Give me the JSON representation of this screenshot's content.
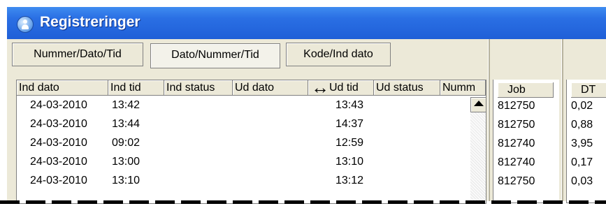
{
  "window": {
    "title": "Registreringer",
    "icon": "user-icon"
  },
  "tabs": [
    {
      "label": "Nummer/Dato/Tid",
      "selected": false
    },
    {
      "label": "Dato/Nummer/Tid",
      "selected": true
    },
    {
      "label": "Kode/Ind dato",
      "selected": false
    }
  ],
  "main_table": {
    "columns": [
      "Ind dato",
      "Ind tid",
      "Ind status",
      "Ud dato",
      "Ud tid",
      "Ud status",
      "Numm"
    ],
    "rows": [
      {
        "ind_dato": "24-03-2010",
        "ind_tid": "13:42",
        "ud_tid": "13:43"
      },
      {
        "ind_dato": "24-03-2010",
        "ind_tid": "13:44",
        "ud_tid": "14:37"
      },
      {
        "ind_dato": "24-03-2010",
        "ind_tid": "09:02",
        "ud_tid": "12:59"
      },
      {
        "ind_dato": "24-03-2010",
        "ind_tid": "13:00",
        "ud_tid": "13:10"
      },
      {
        "ind_dato": "24-03-2010",
        "ind_tid": "13:10",
        "ud_tid": "13:12"
      }
    ],
    "cursor_icon": "column-resize-cursor-icon",
    "scroll_up_icon": "scroll-up-arrow-icon"
  },
  "job_table": {
    "column": "Job",
    "rows": [
      "812750",
      "812750",
      "812740",
      "812740",
      "812750"
    ]
  },
  "dt_table": {
    "column": "DT",
    "rows": [
      "0,02",
      "0,88",
      "3,95",
      "0,17",
      "0,03"
    ]
  }
}
